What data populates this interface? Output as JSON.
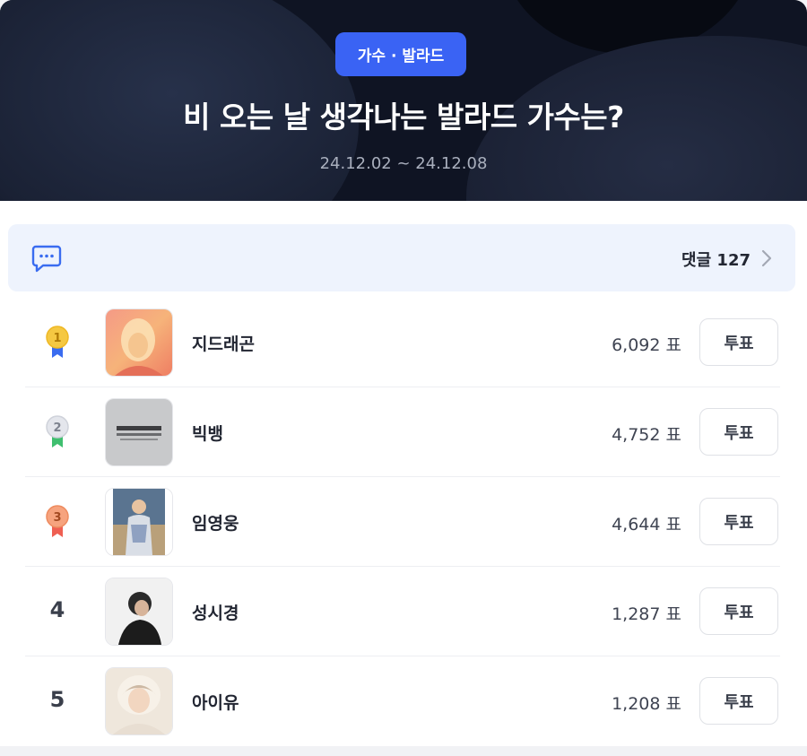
{
  "header": {
    "category_badge": "가수 · 발라드",
    "title": "비 오는 날 생각나는 발라드 가수는?",
    "period": "24.12.02 ~ 24.12.08"
  },
  "comments": {
    "icon": "chat-icon",
    "label": "댓글 127"
  },
  "ranking": [
    {
      "rank": "1",
      "name": "지드래곤",
      "votes": "6,092 표",
      "button": "투표",
      "medal": "gold"
    },
    {
      "rank": "2",
      "name": "빅뱅",
      "votes": "4,752 표",
      "button": "투표",
      "medal": "silver"
    },
    {
      "rank": "3",
      "name": "임영웅",
      "votes": "4,644 표",
      "button": "투표",
      "medal": "bronze"
    },
    {
      "rank": "4",
      "name": "성시경",
      "votes": "1,287 표",
      "button": "투표"
    },
    {
      "rank": "5",
      "name": "아이유",
      "votes": "1,208 표",
      "button": "투표"
    }
  ],
  "colors": {
    "accent": "#3a63f4",
    "header_bg": "#0f1423",
    "comments_bg": "#eef3fd",
    "medal_gold": "#f5c842",
    "medal_silver": "#e4e6ec",
    "medal_bronze": "#f6a37e",
    "ribbon_gold": "#3a6cf0",
    "ribbon_silver": "#3fbf6f",
    "ribbon_bronze": "#ef5f52"
  }
}
